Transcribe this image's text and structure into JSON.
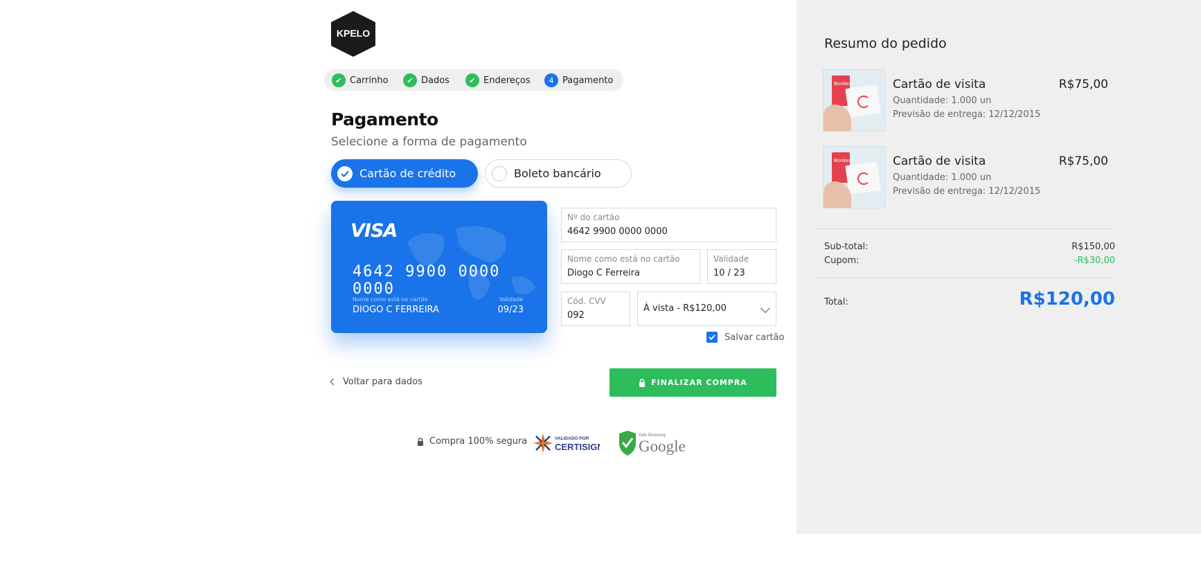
{
  "brand": {
    "logo_text": "KPELO"
  },
  "steps": [
    {
      "label": "Carrinho",
      "state": "done"
    },
    {
      "label": "Dados",
      "state": "done"
    },
    {
      "label": "Endereços",
      "state": "done"
    },
    {
      "label": "Pagamento",
      "state": "current",
      "number": "4"
    }
  ],
  "payment": {
    "title": "Pagamento",
    "subtitle": "Selecione a forma de pagamento",
    "options": [
      {
        "label": "Cartão de crédito",
        "selected": true
      },
      {
        "label": "Boleto bancário",
        "selected": false
      }
    ]
  },
  "card_preview": {
    "brand": "VISA",
    "number": "4642 9900 0000 0000",
    "name_label": "Nome como está no cartão",
    "name": "DIOGO C FERREIRA",
    "validity_label": "Validade",
    "validity": "09/23"
  },
  "form": {
    "card_number": {
      "label": "Nº do cartão",
      "value": "4642  9900 0000  0000"
    },
    "name": {
      "label": "Nome como está no cartão",
      "value": "Diogo C Ferreira"
    },
    "validity": {
      "label": "Validade",
      "value": "10 / 23"
    },
    "cvv": {
      "label": "Cód. CVV",
      "value": "092"
    },
    "installments": {
      "value": "À vista - R$120,00"
    },
    "save_card": {
      "label": "Salvar cartão",
      "checked": true
    }
  },
  "actions": {
    "back_label": "Voltar para dados",
    "finish_label": "FINALIZAR COMPRA"
  },
  "trust": {
    "secure_label": "Compra 100% segura",
    "certisign_top": "VALIDADO POR",
    "certisign_name": "CERTISIGN",
    "google_top": "Safe Browsing",
    "google_name": "Google"
  },
  "summary": {
    "title": "Resumo do pedido",
    "items": [
      {
        "name": "Cartão de visita",
        "quantity": "Quantidade: 1.000 un",
        "delivery": "Previsão de entrega: 12/12/2015",
        "price": "R$75,00",
        "thumb_text": "Bookess"
      },
      {
        "name": "Cartão de visita",
        "quantity": "Quantidade: 1.000 un",
        "delivery": "Previsão de entrega: 12/12/2015",
        "price": "R$75,00",
        "thumb_text": "Bookess"
      }
    ],
    "subtotal_label": "Sub-total:",
    "subtotal_value": "R$150,00",
    "coupon_label": "Cupom:",
    "coupon_value": "-R$30,00",
    "total_label": "Total:",
    "total_value": "R$120,00"
  },
  "colors": {
    "primary": "#1a73e8",
    "success": "#2dbd5c",
    "panel_bg": "#efefef"
  }
}
